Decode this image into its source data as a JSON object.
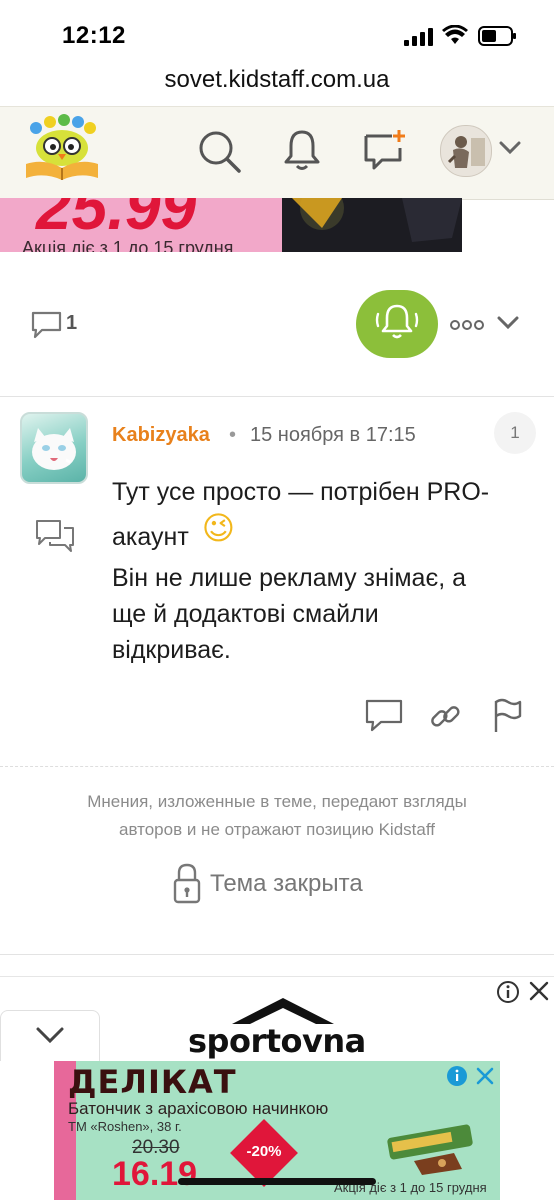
{
  "status_bar": {
    "time": "12:12"
  },
  "browser": {
    "url": "sovet.kidstaff.com.ua"
  },
  "header": {
    "logo_icon": "kidstaff-owl-book-logo",
    "search_icon": "search-icon",
    "bell_icon": "bell-icon",
    "new_message_icon": "chat-plus-icon",
    "accent": "#f07c1a"
  },
  "top_ad": {
    "price": "25.99",
    "subtitle": "Акція діє з 1 до 15 грудня"
  },
  "topic_actions": {
    "comments_count": "1",
    "subscribe_color": "#8cbf3a"
  },
  "post": {
    "author": "Kabizyaka",
    "separator": "•",
    "date": "15 ноября в 17:15",
    "number": "1",
    "lines": [
      "Тут усе просто — потрібен PRO-",
      "акаунт",
      "Він не лише рекламу знімає, а",
      "ще й додактові смайли",
      "відкриває."
    ],
    "emoji": "😉"
  },
  "footer": {
    "disclaimer_line1": "Мнения, изложенные в теме, передают взгляды",
    "disclaimer_line2": "авторов и не отражают позицию Kidstaff",
    "closed_label": "Тема закрыта"
  },
  "bottom_ad": {
    "sportovna": "sportovna",
    "brand": "ДЕЛІКАТ",
    "title": "Батончик з арахісовою начинкою",
    "tm": "ТМ «Roshen», 38 г.",
    "old_price": "20.30",
    "new_price": "16.19",
    "discount": "-20%",
    "period": "Акція діє з 1 до 15 грудня"
  }
}
